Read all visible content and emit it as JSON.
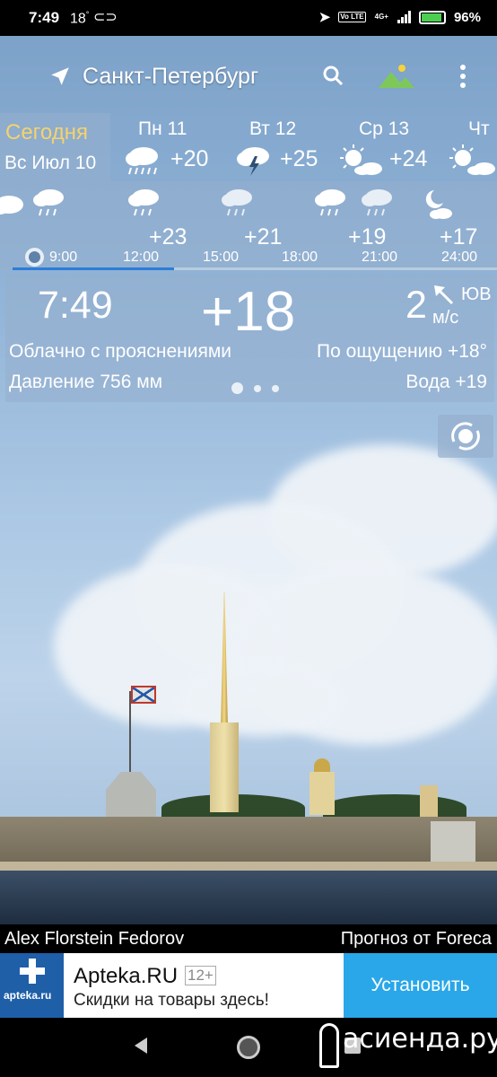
{
  "status_bar": {
    "time": "7:49",
    "temperature": "18",
    "degree_mark": "°",
    "network": "4G+",
    "volte": "Vo LTE",
    "battery": "96%"
  },
  "header": {
    "city": "Санкт-Петербург",
    "location_icon": "navigation-arrow-icon",
    "search_icon": "search-icon",
    "background_icon": "landscape-icon",
    "menu_icon": "more-vert-icon"
  },
  "days": {
    "today": {
      "label": "Сегодня",
      "date": "Вс Июл 10"
    },
    "list": [
      {
        "name": "Пн 11",
        "temp": "+20",
        "icon": "heavy-rain-cloud-icon"
      },
      {
        "name": "Вт 12",
        "temp": "+25",
        "icon": "thunderstorm-cloud-icon"
      },
      {
        "name": "Ср 13",
        "temp": "+24",
        "icon": "sun-behind-cloud-icon"
      },
      {
        "name": "Чт",
        "temp": "",
        "icon": "sun-behind-cloud-icon"
      }
    ]
  },
  "hourly": {
    "items": [
      {
        "time": "9:00",
        "temp": "",
        "icon": "rain-cloud-icon"
      },
      {
        "time": "12:00",
        "temp": "+23",
        "icon": "rain-cloud-icon"
      },
      {
        "time": "15:00",
        "temp": "+21",
        "icon": "light-rain-cloud-icon"
      },
      {
        "time": "18:00",
        "temp": "",
        "icon": "rain-cloud-icon"
      },
      {
        "time": "21:00",
        "temp": "+19",
        "icon": "light-rain-cloud-icon"
      },
      {
        "time": "24:00",
        "temp": "+17",
        "icon": "moon-cloud-icon"
      }
    ]
  },
  "current": {
    "time": "7:49",
    "temp": "+18",
    "wind_speed": "2",
    "wind_direction": "ЮВ",
    "wind_unit": "м/с",
    "condition": "Облачно с прояснениями",
    "feels_like": "По ощущению +18°",
    "pressure": "Давление 756 мм",
    "water": "Вода +19",
    "page_count": 3,
    "active_page": 1
  },
  "theme_button_icon": "weather-theme-icon",
  "credits": {
    "photo_author": "Alex Florstein Fedorov",
    "forecast_source": "Прогноз от Foreca"
  },
  "ad": {
    "logo_text": "apteka.ru",
    "title": "Apteka.RU",
    "age": "12+",
    "subtitle": "Скидки на товары здесь!",
    "cta": "Установить"
  },
  "watermark": "асиенда.ру",
  "colors": {
    "today_label": "#f4d36c",
    "timeline_accent": "#2c7dd8",
    "ad_cta": "#2aa7e8",
    "ad_logo": "#1f5fa8",
    "battery": "#4ccf50"
  }
}
